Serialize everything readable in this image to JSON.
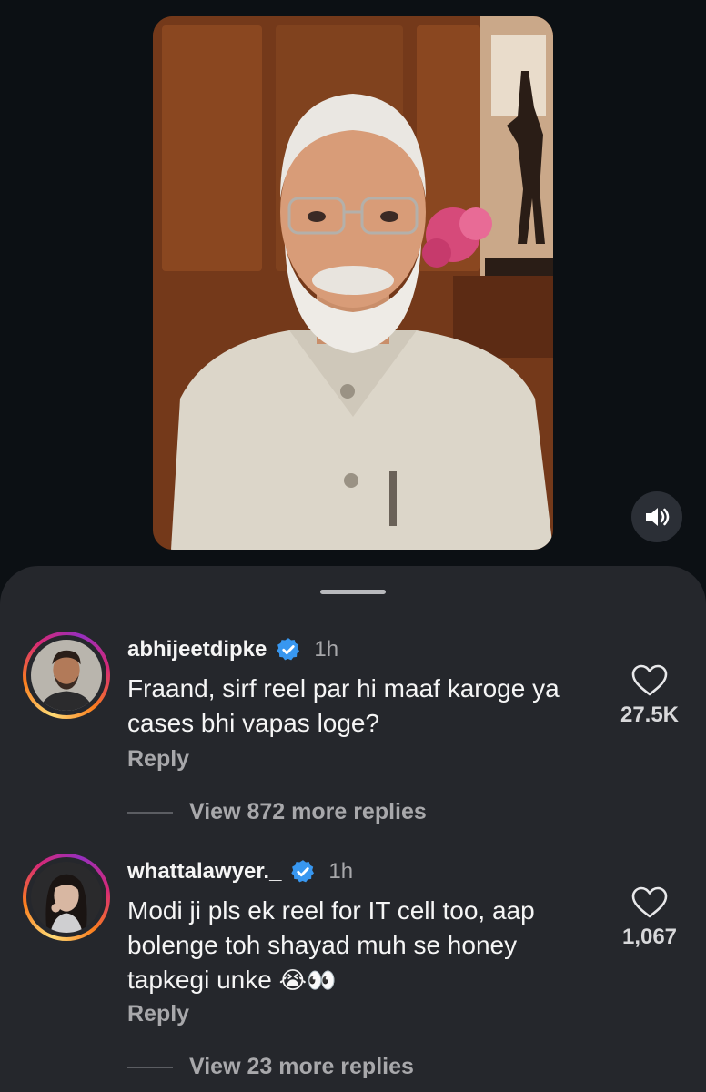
{
  "comments": [
    {
      "username": "abhijeetdipke",
      "time": "1h",
      "text": "Fraand, sirf reel par hi maaf karoge ya cases bhi vapas loge?",
      "likes": "27.5K",
      "reply_label": "Reply",
      "view_more": "View 872 more replies"
    },
    {
      "username": "whattalawyer._",
      "time": "1h",
      "text": "Modi ji pls ek reel for IT cell too, aap bolenge toh shayad muh se honey tapkegi unke ",
      "emoji": "😭👀",
      "likes": "1,067",
      "reply_label": "Reply",
      "view_more": "View 23 more replies"
    }
  ],
  "colors": {
    "background": "#0c1014",
    "sheet": "#25272c",
    "verified": "#3897f0",
    "secondary_text": "#a8a8ab"
  },
  "icons": {
    "mute": "speaker-icon",
    "like": "heart-outline-icon",
    "verified": "verified-badge-icon"
  }
}
